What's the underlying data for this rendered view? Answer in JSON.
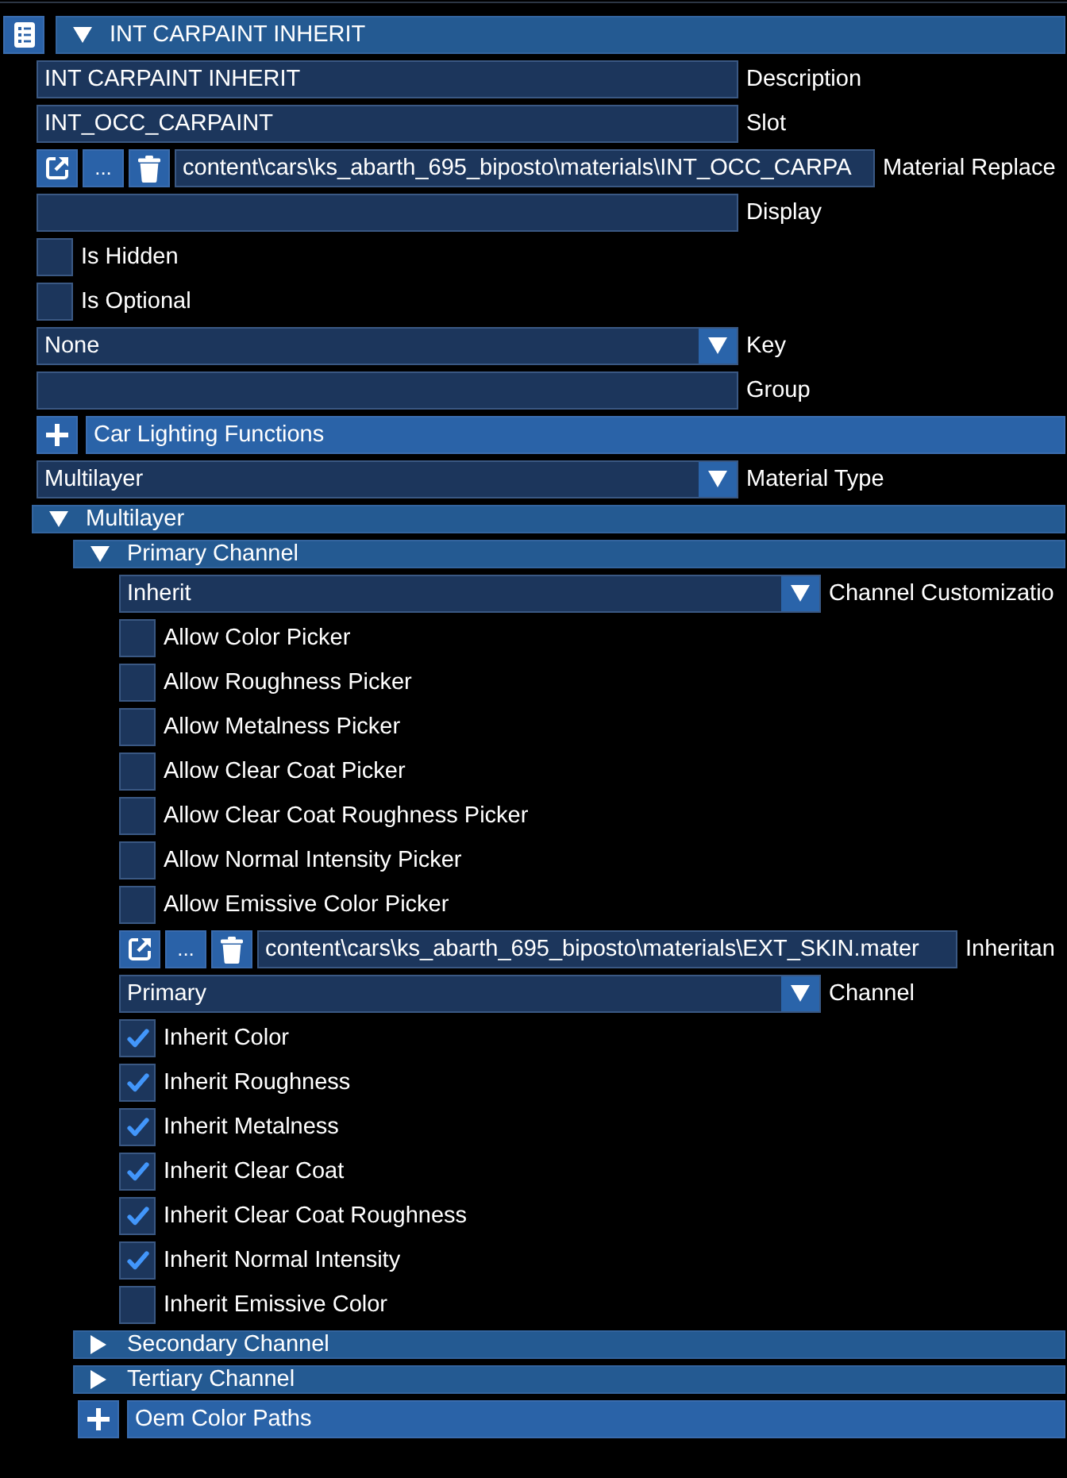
{
  "material": {
    "title": "INT CARPAINT INHERIT",
    "expanded": true,
    "items": [
      {
        "kind": "text_field",
        "value": "INT CARPAINT INHERIT",
        "label": "Description"
      },
      {
        "kind": "text_field",
        "value": "INT_OCC_CARPAINT",
        "label": "Slot"
      },
      {
        "kind": "path_field",
        "browse": "...",
        "value": "content\\cars\\ks_abarth_695_biposto\\materials\\INT_OCC_CARPA",
        "label": "Material Replace"
      },
      {
        "kind": "text_field",
        "label": "Display"
      },
      {
        "kind": "checkbox",
        "label": "Is Hidden",
        "checked": false
      },
      {
        "kind": "checkbox",
        "label": "Is Optional",
        "checked": false
      },
      {
        "kind": "dropdown",
        "option": "None",
        "label": "Key"
      },
      {
        "kind": "text_field",
        "label": "Group"
      },
      {
        "kind": "add_list",
        "label": "Car Lighting Functions"
      },
      {
        "kind": "dropdown",
        "option": "Multilayer",
        "label": "Material Type"
      },
      {
        "kind": "section",
        "title": "Multilayer",
        "expanded": true,
        "children": [
          {
            "kind": "section",
            "title": "Primary Channel",
            "expanded": true,
            "children": [
              {
                "kind": "dropdown",
                "option": "Inherit",
                "label": "Channel Customizatio"
              },
              {
                "kind": "checkbox",
                "label": "Allow Color Picker",
                "checked": false
              },
              {
                "kind": "checkbox",
                "label": "Allow Roughness Picker",
                "checked": false
              },
              {
                "kind": "checkbox",
                "label": "Allow Metalness Picker",
                "checked": false
              },
              {
                "kind": "checkbox",
                "label": "Allow Clear Coat Picker",
                "checked": false
              },
              {
                "kind": "checkbox",
                "label": "Allow Clear Coat Roughness Picker",
                "checked": false
              },
              {
                "kind": "checkbox",
                "label": "Allow Normal Intensity Picker",
                "checked": false
              },
              {
                "kind": "checkbox",
                "label": "Allow Emissive Color Picker",
                "checked": false
              },
              {
                "kind": "path_field",
                "browse": "...",
                "value": "content\\cars\\ks_abarth_695_biposto\\materials\\EXT_SKIN.mater",
                "label": "Inheritan"
              },
              {
                "kind": "dropdown",
                "option": "Primary",
                "label": "Channel"
              },
              {
                "kind": "checkbox",
                "label": "Inherit Color",
                "checked": true
              },
              {
                "kind": "checkbox",
                "label": "Inherit Roughness",
                "checked": true
              },
              {
                "kind": "checkbox",
                "label": "Inherit Metalness",
                "checked": true
              },
              {
                "kind": "checkbox",
                "label": "Inherit Clear Coat",
                "checked": true
              },
              {
                "kind": "checkbox",
                "label": "Inherit Clear Coat Roughness",
                "checked": true
              },
              {
                "kind": "checkbox",
                "label": "Inherit Normal Intensity",
                "checked": true
              },
              {
                "kind": "checkbox",
                "label": "Inherit Emissive Color",
                "checked": false
              }
            ]
          },
          {
            "kind": "section",
            "title": "Secondary Channel",
            "expanded": false
          },
          {
            "kind": "section",
            "title": "Tertiary Channel",
            "expanded": false
          },
          {
            "kind": "add_list",
            "label": "Oem Color Paths"
          }
        ]
      }
    ]
  }
}
